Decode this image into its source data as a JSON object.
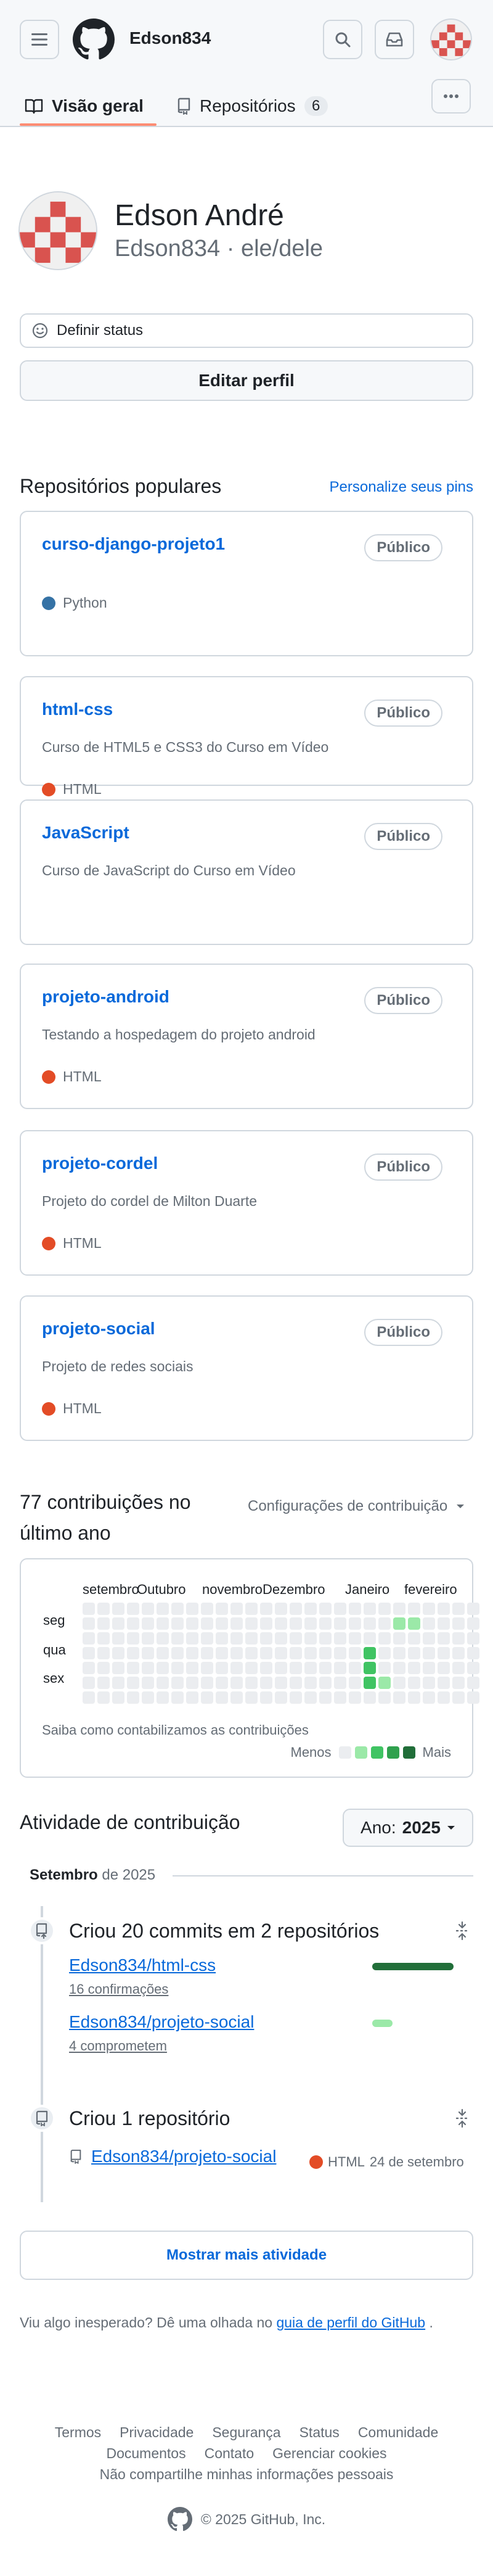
{
  "header": {
    "username": "Edson834"
  },
  "tabs": {
    "overview_label": "Visão geral",
    "repos_label": "Repositórios",
    "repos_count": "6"
  },
  "profile": {
    "full_name": "Edson André",
    "login": "Edson834",
    "pronouns": "ele/dele",
    "status_label": "Definir status",
    "edit_label": "Editar perfil"
  },
  "popular": {
    "title": "Repositórios populares",
    "customize_label": "Personalize seus pins",
    "badge_label": "Público",
    "repos": [
      {
        "name": "curso-django-projeto1",
        "description": "",
        "language": "Python",
        "lang_color": "#3572A5"
      },
      {
        "name": "html-css",
        "description": "Curso de HTML5 e CSS3 do Curso em Vídeo",
        "language": "HTML",
        "lang_color": "#e34c26"
      },
      {
        "name": "JavaScript",
        "description": "Curso de JavaScript do Curso em Vídeo",
        "language": "",
        "lang_color": ""
      },
      {
        "name": "projeto-android",
        "description": "Testando a hospedagem do projeto android",
        "language": "HTML",
        "lang_color": "#e34c26"
      },
      {
        "name": "projeto-cordel",
        "description": "Projeto do cordel de Milton Duarte",
        "language": "HTML",
        "lang_color": "#e34c26"
      },
      {
        "name": "projeto-social",
        "description": "Projeto de redes sociais",
        "language": "HTML",
        "lang_color": "#e34c26"
      }
    ]
  },
  "contributions": {
    "title": "77 contribuições no último ano",
    "settings_label": "Configurações de contribuição",
    "months": [
      "setembro",
      "Outubro",
      "novembro",
      "Dezembro",
      "Janeiro",
      "fevereiro"
    ],
    "days": [
      "seg",
      "qua",
      "sex"
    ],
    "help_text": "Saiba como contabilizamos as contribuições",
    "less_label": "Menos",
    "more_label": "Mais",
    "colors": [
      "#ebedf0",
      "#9be9a8",
      "#40c463",
      "#30a14e",
      "#216e39"
    ]
  },
  "activity": {
    "title": "Atividade de contribuição",
    "year_prefix": "Ano:",
    "year": "2025",
    "month": "Setembro",
    "month_year": "de 2025",
    "commits_title": "Criou 20 commits em 2 repositórios",
    "commit_repos": [
      {
        "name": "Edson834/html-css",
        "count_label": "16 confirmações",
        "share": 0.8
      },
      {
        "name": "Edson834/projeto-social",
        "count_label": "4 comprometem",
        "share": 0.2
      }
    ],
    "created_title": "Criou 1 repositório",
    "created_repo": "Edson834/projeto-social",
    "created_lang": "HTML",
    "created_date": "24 de setembro",
    "show_more_label": "Mostrar mais atividade"
  },
  "unexpected": {
    "prefix": "Viu algo inesperado? Dê uma olhada no",
    "link": "guia de perfil do GitHub",
    "suffix": "."
  },
  "footer": {
    "terms": "Termos",
    "privacy": "Privacidade",
    "security": "Segurança",
    "status": "Status",
    "community": "Comunidade",
    "docs": "Documentos",
    "contact": "Contato",
    "cookies": "Gerenciar cookies",
    "no_share": "Não compartilhe minhas informações pessoais",
    "copyright": "© 2025 GitHub, Inc."
  }
}
